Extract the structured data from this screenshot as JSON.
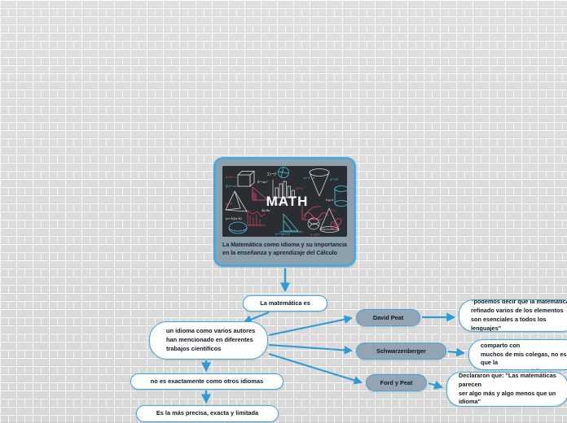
{
  "app": {
    "type": "mind-map",
    "background_style": "subway-tile-brick",
    "accent_color": "#41a6dd",
    "node_fill_white": "#ffffff",
    "node_fill_gray_blue": "#93a4b2",
    "canvas_color": "#dcdcdc"
  },
  "root": {
    "title": "La Matemática como idioma y su importancia en la enseñanza y aprendizaje del Cálculo",
    "image_alt": "MATH",
    "image_caption_word": "MATH",
    "image_description": "blackboard with colorful hand-drawn math doodles"
  },
  "nodes": {
    "la_matematica_es": "La matemática es",
    "un_idioma": "un idioma como varios autores han mencionado en diferentes trabajos científicos",
    "no_es_exactamente": "no es exactamente como otros idiomas",
    "es_la_mas_precisa": "Es la más precisa, exacta y limitada"
  },
  "authors": [
    {
      "name": "David Peat",
      "quote": "\"podemos decir que la matemática\nrefinado varios de los elementos\nson esenciales a todos los lenguajes\""
    },
    {
      "name": "Schwarzenberger",
      "quote": "\"Mi propia actitud, que yo comparto con\nmuchos de mis colegas, no es que la\nmatemática es un idioma\""
    },
    {
      "name": "Ford y Peat",
      "quote": "Declararon que: \"Las matemáticas parecen\nser algo más y algo menos que un\nidioma\""
    }
  ]
}
